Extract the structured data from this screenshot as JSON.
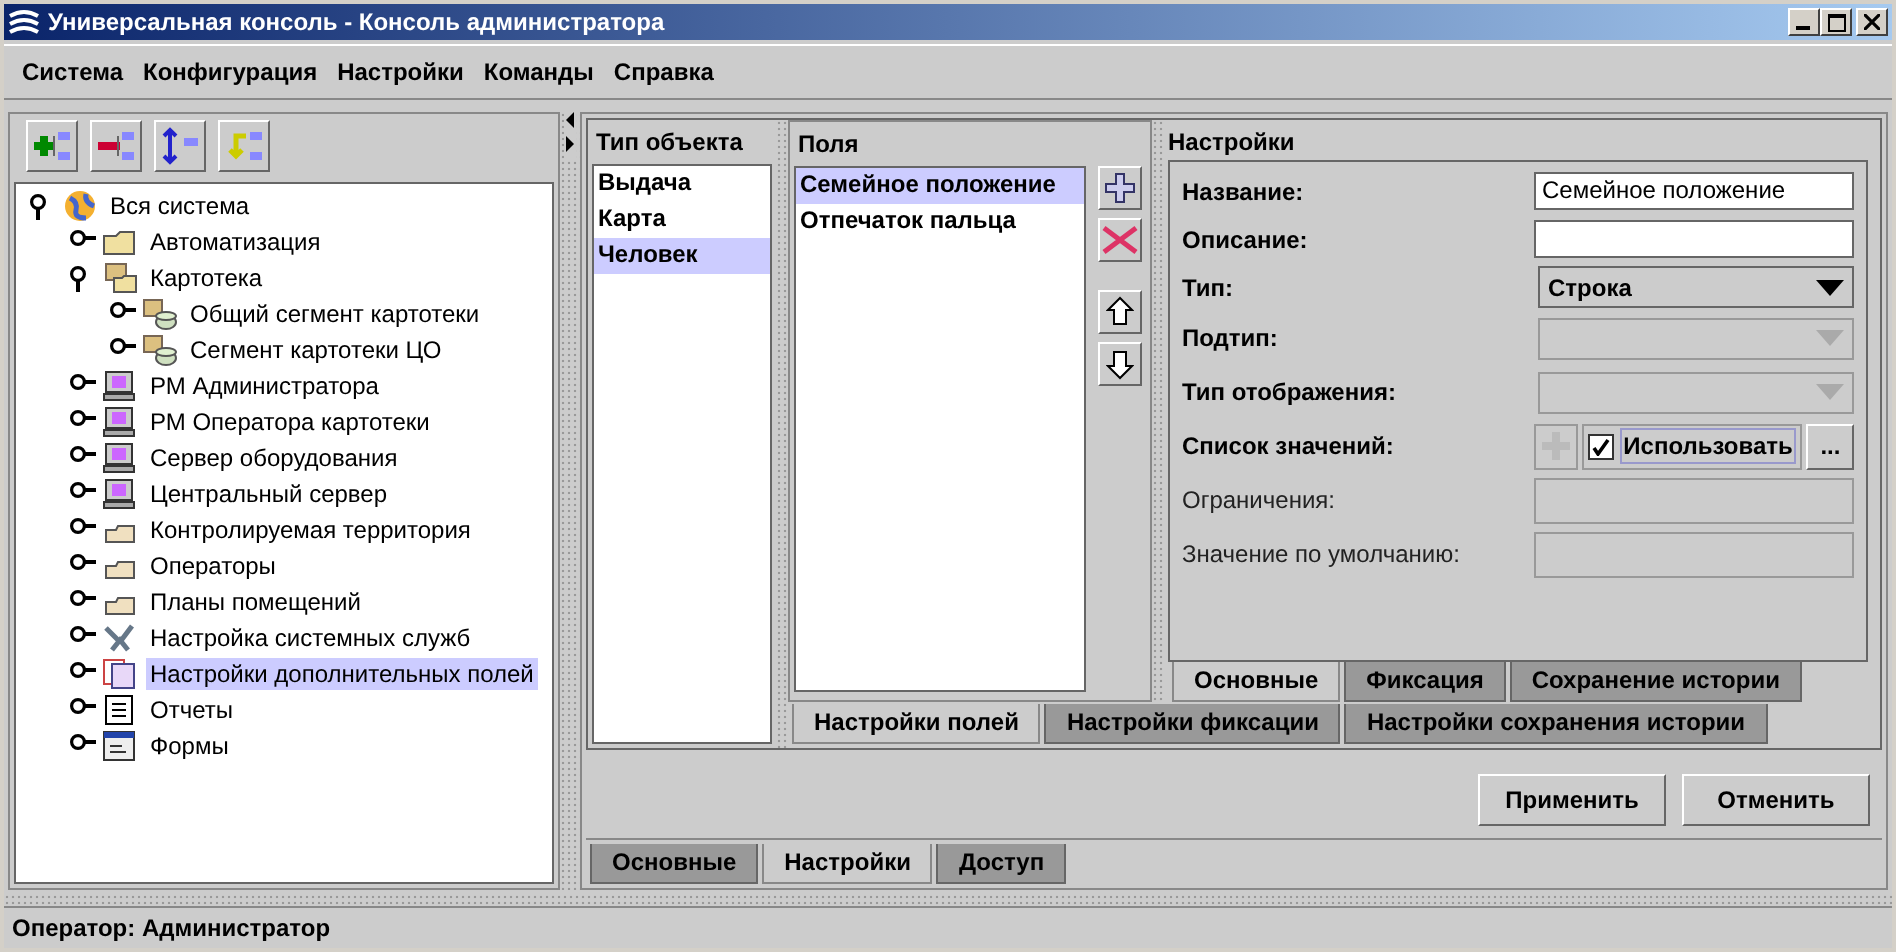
{
  "window": {
    "title": "Универсальная консоль - Консоль администратора"
  },
  "menu": [
    "Система",
    "Конфигурация",
    "Настройки",
    "Команды",
    "Справка"
  ],
  "tree": [
    {
      "label": "Вся система",
      "kind": "globe",
      "expanded": true,
      "selected": false,
      "children": [
        {
          "label": "Автоматизация",
          "kind": "folder",
          "expanded": false,
          "selected": false
        },
        {
          "label": "Картотека",
          "kind": "cards",
          "expanded": true,
          "selected": false,
          "children": [
            {
              "label": "Общий сегмент картотеки",
              "kind": "database",
              "expanded": false,
              "selected": false
            },
            {
              "label": "Сегмент картотеки ЦО",
              "kind": "database",
              "expanded": false,
              "selected": false
            }
          ]
        },
        {
          "label": "РМ Администратора",
          "kind": "computer",
          "expanded": false,
          "selected": false
        },
        {
          "label": "РМ Оператора картотеки",
          "kind": "computer",
          "expanded": false,
          "selected": false
        },
        {
          "label": "Сервер оборудования",
          "kind": "computer",
          "expanded": false,
          "selected": false
        },
        {
          "label": "Центральный сервер",
          "kind": "computer",
          "expanded": false,
          "selected": false
        },
        {
          "label": "Контролируемая территория",
          "kind": "tray",
          "expanded": false,
          "selected": false
        },
        {
          "label": "Операторы",
          "kind": "tray",
          "expanded": false,
          "selected": false
        },
        {
          "label": "Планы помещений",
          "kind": "tray",
          "expanded": false,
          "selected": false
        },
        {
          "label": "Настройка системных служб",
          "kind": "tools",
          "expanded": false,
          "selected": false
        },
        {
          "label": "Настройки дополнительных полей",
          "kind": "pages",
          "expanded": false,
          "selected": true
        },
        {
          "label": "Отчеты",
          "kind": "report",
          "expanded": false,
          "selected": false
        },
        {
          "label": "Формы",
          "kind": "form",
          "expanded": false,
          "selected": false
        }
      ]
    }
  ],
  "object_types": {
    "header": "Тип объекта",
    "items": [
      {
        "label": "Выдача",
        "selected": false
      },
      {
        "label": "Карта",
        "selected": false
      },
      {
        "label": "Человек",
        "selected": true
      }
    ]
  },
  "fields": {
    "header": "Поля",
    "items": [
      {
        "label": "Семейное положение",
        "selected": true
      },
      {
        "label": "Отпечаток пальца",
        "selected": false
      }
    ]
  },
  "settings": {
    "header": "Настройки",
    "rows": [
      {
        "kind": "text",
        "label": "Название:",
        "value": "Семейное положение",
        "disabled": false
      },
      {
        "kind": "text",
        "label": "Описание:",
        "disabled": false
      },
      {
        "kind": "select",
        "label": "Тип:",
        "value": "Строка",
        "disabled": false
      },
      {
        "kind": "select",
        "label": "Подтип:",
        "disabled": true
      },
      {
        "kind": "select",
        "label": "Тип отображения:",
        "disabled": true
      },
      {
        "kind": "list",
        "label": "Список значений:",
        "checkbox_label": "Использовать",
        "checked": true,
        "more_label": "..."
      },
      {
        "kind": "text",
        "label": "Ограничения:",
        "disabled": true
      },
      {
        "kind": "text",
        "label": "Значение по умолчанию:",
        "disabled": true
      }
    ]
  },
  "settings_tabs": [
    {
      "label": "Основные",
      "selected": true
    },
    {
      "label": "Фиксация",
      "selected": false
    },
    {
      "label": "Сохранение истории",
      "selected": false
    }
  ],
  "field_tabs": [
    {
      "label": "Настройки полей",
      "selected": true
    },
    {
      "label": "Настройки фиксации",
      "selected": false
    },
    {
      "label": "Настройки сохранения истории",
      "selected": false
    }
  ],
  "buttons": [
    "Применить",
    "Отменить"
  ],
  "bottom_tabs": [
    {
      "label": "Основные",
      "selected": false
    },
    {
      "label": "Настройки",
      "selected": true
    },
    {
      "label": "Доступ",
      "selected": false
    }
  ],
  "status_bar": "Оператор: Администратор"
}
